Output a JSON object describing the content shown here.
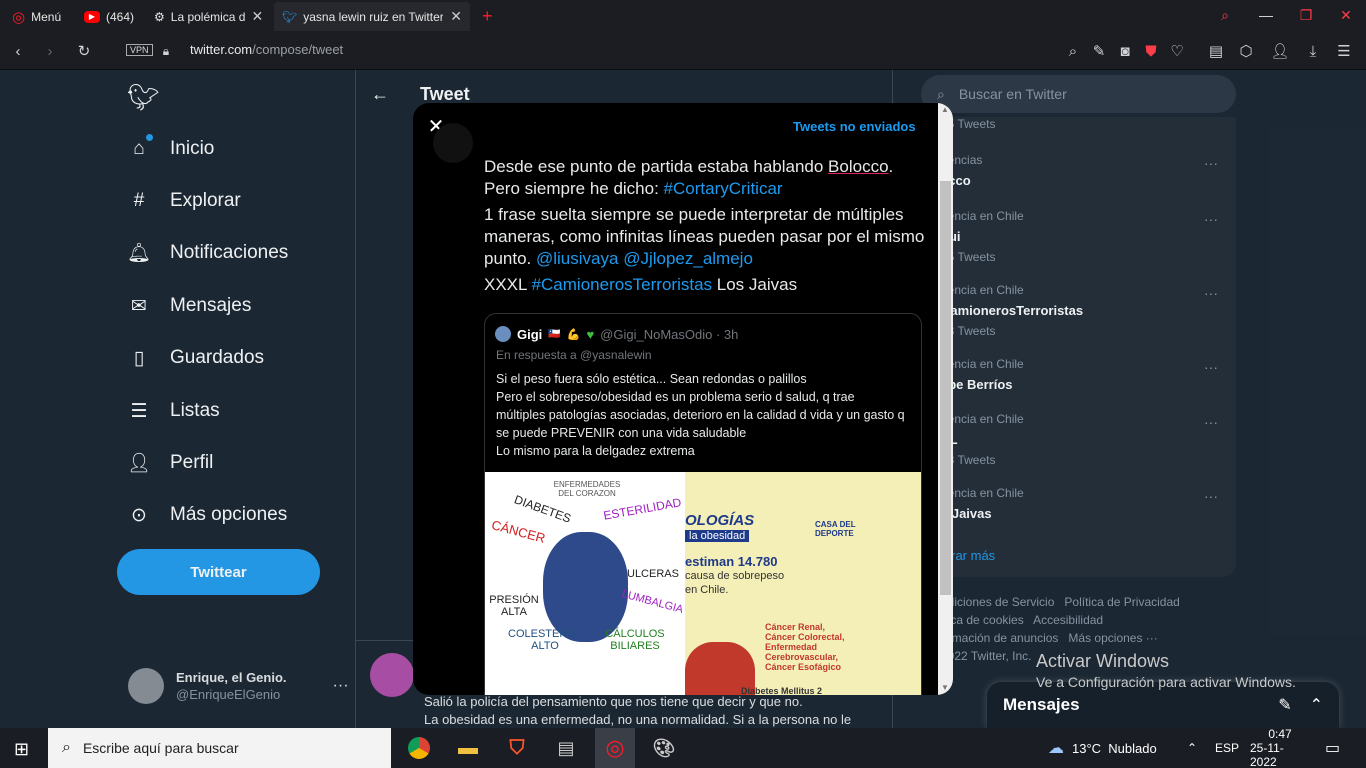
{
  "browser": {
    "menu_label": "Menú",
    "tabs": [
      {
        "label": "(464)",
        "icon": "youtube-icon"
      },
      {
        "label": "La polémica d",
        "icon": "gear-icon"
      },
      {
        "label": "yasna lewin ruiz en Twitter",
        "icon": "twitter-icon"
      }
    ],
    "url_host": "twitter.com",
    "url_path": "/compose/tweet",
    "vpn_label": "VPN"
  },
  "nav": {
    "items": [
      {
        "label": "Inicio",
        "icon": "home-icon"
      },
      {
        "label": "Explorar",
        "icon": "hashtag-icon"
      },
      {
        "label": "Notificaciones",
        "icon": "bell-icon"
      },
      {
        "label": "Mensajes",
        "icon": "mail-icon"
      },
      {
        "label": "Guardados",
        "icon": "bookmark-icon"
      },
      {
        "label": "Listas",
        "icon": "list-icon"
      },
      {
        "label": "Perfil",
        "icon": "person-icon"
      },
      {
        "label": "Más opciones",
        "icon": "more-circle-icon"
      }
    ],
    "tweet_button": "Twittear",
    "account_name": "Enrique, el Genio.",
    "account_handle": "@EnriqueElGenio"
  },
  "center": {
    "header_title": "Tweet",
    "bg_tweet_line1": "Salió la policía del pensamiento que nos tiene que decir y que no.",
    "bg_tweet_line2": "La obesidad es una enfermedad, no una normalidad. Si a la persona no le"
  },
  "modal": {
    "unsent_label": "Tweets no enviados",
    "body": {
      "p1_a": "Desde ese punto de partida estaba hablando ",
      "p1_b": "Bolocco",
      "p1_c": ".",
      "p2_a": "Pero siempre he dicho: ",
      "p2_tag": "#CortaryCriticar",
      "p3": "1 frase suelta siempre se puede interpretar de múltiples maneras, como infinitas líneas pueden pasar por el mismo punto. ",
      "p3_m1": "@liusivaya",
      "p3_m2": "@Jjlopez_almejo",
      "p4_a": "XXXL ",
      "p4_tag": "#CamionerosTerroristas",
      "p4_b": " Los Jaivas"
    },
    "quote": {
      "name": "Gigi",
      "handle": "@Gigi_NoMasOdio · 3h",
      "reply": "En respuesta a @yasnalewin",
      "lines": [
        "Si el peso fuera sólo estética... Sean redondas o palillos",
        "Pero el sobrepeso/obesidad es un problema serio d salud, q trae múltiples patologías asociadas, deterioro en la calidad d vida y un gasto q se puede PREVENIR con una vida saludable",
        "Lo mismo para la delgadez extrema"
      ],
      "img_left_labels": [
        "ENFERMEDADES DEL CORAZON",
        "DIABETES",
        "ESTERILIDAD",
        "CÁNCER",
        "ULCERAS",
        "PRESIÓN ALTA",
        "LUMBALGIA",
        "COLESTEROL ALTO",
        "CÁLCULOS BILIARES"
      ],
      "img_right_labels": [
        "OLOGÍAS",
        "la obesidad",
        "CASA DEL DEPORTE",
        "estiman 14.780",
        "causa de sobrepeso",
        "en Chile.",
        "Cáncer Renal,",
        "Cáncer Colorectal,",
        "Enfermedad",
        "Cerebrovascular,",
        "Cáncer Esofágico",
        "Diabetes Mellitus 2"
      ]
    }
  },
  "right": {
    "search_placeholder": "Buscar en Twitter",
    "trends": [
      {
        "meta": "",
        "name": "",
        "count": "25 Tweets"
      },
      {
        "meta": "dencias",
        "name": "ecco",
        "count": ""
      },
      {
        "meta": "dencia en Chile",
        "name": "hui",
        "count": "05 Tweets"
      },
      {
        "meta": "dencia en Chile",
        "name": "CamionerosTerroristas",
        "count": "93 Tweets"
      },
      {
        "meta": "dencia en Chile",
        "name": "lipe Berríos",
        "count": ""
      },
      {
        "meta": "dencia en Chile",
        "name": "XL",
        "count": "33 Tweets"
      },
      {
        "meta": "dencia en Chile",
        "name": "s Jaivas",
        "count": ""
      }
    ],
    "show_more": "strar más",
    "footer": [
      "ndiciones de Servicio",
      "Política de Privacidad",
      "ítica de cookies",
      "Accesibilidad",
      "ormación de anuncios",
      "Más opciones ···",
      "2022 Twitter, Inc."
    ],
    "messages_drawer": "Mensajes"
  },
  "windows": {
    "activate_title": "Activar Windows",
    "activate_sub": "Ve a Configuración para activar Windows.",
    "search_placeholder": "Escribe aquí para buscar",
    "weather": "13°C  Nublado",
    "lang": "ESP",
    "time": "0:47",
    "date": "25-11-2022"
  },
  "colors": {
    "twitter_blue": "#1d9bf0",
    "bg": "#15202b",
    "modal_bg": "#000000"
  }
}
